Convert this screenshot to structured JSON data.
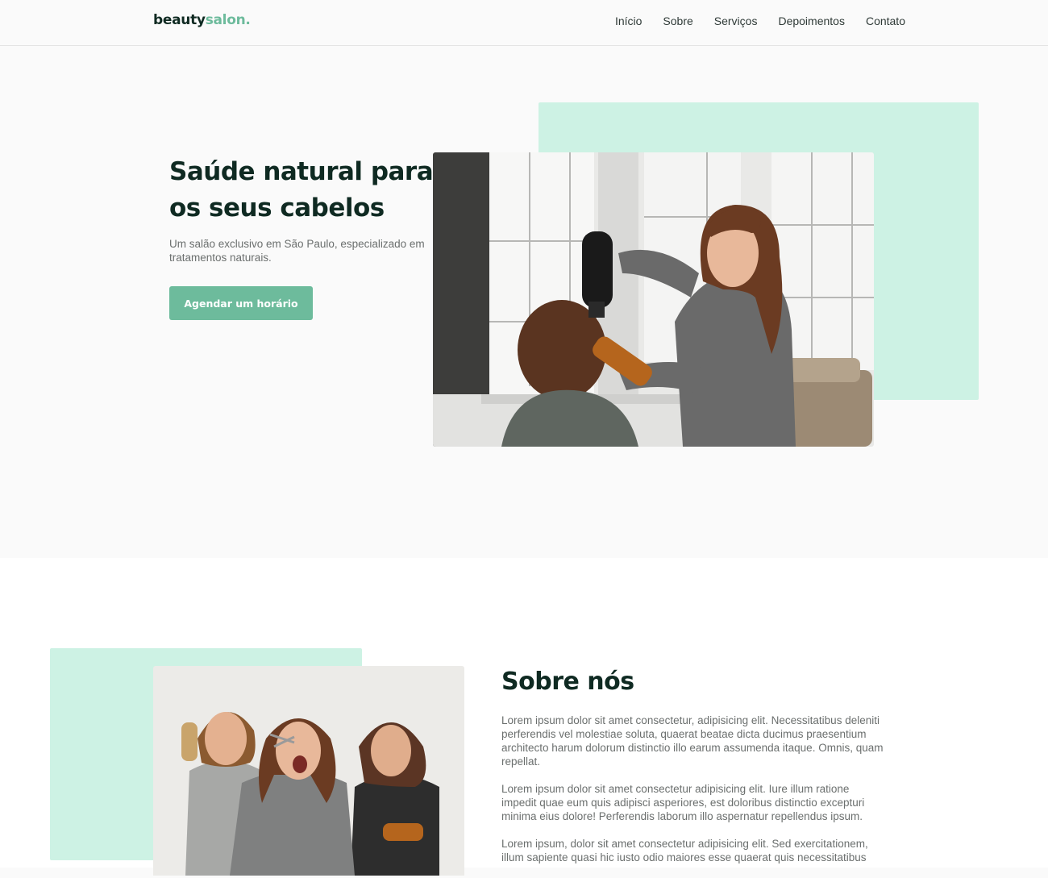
{
  "header": {
    "logo_main": "beauty",
    "logo_accent": "salon.",
    "nav": [
      "Início",
      "Sobre",
      "Serviços",
      "Depoimentos",
      "Contato"
    ]
  },
  "hero": {
    "title": "Saúde natural para os seus cabelos",
    "subtitle": "Um salão exclusivo em São Paulo, especializado em tratamentos naturais.",
    "cta_label": "Agendar um horário"
  },
  "about": {
    "title": "Sobre nós",
    "paragraphs": [
      "Lorem ipsum dolor sit amet consectetur, adipisicing elit. Necessitatibus deleniti perferendis vel molestiae soluta, quaerat beatae dicta ducimus praesentium architecto harum dolorum distinctio illo earum assumenda itaque. Omnis, quam repellat.",
      "Lorem ipsum dolor sit amet consectetur adipisicing elit. Iure illum ratione impedit quae eum quis adipisci asperiores, est doloribus distinctio excepturi minima eius dolore! Perferendis laborum illo aspernatur repellendus ipsum.",
      "Lorem ipsum, dolor sit amet consectetur adipisicing elit. Sed exercitationem, illum sapiente quasi hic iusto odio maiores esse quaerat quis necessitatibus"
    ]
  },
  "colors": {
    "accent": "#6dbb9c",
    "mint": "#cdf2e4",
    "heading": "#0f2a22",
    "body_text": "#6b6f6e"
  }
}
